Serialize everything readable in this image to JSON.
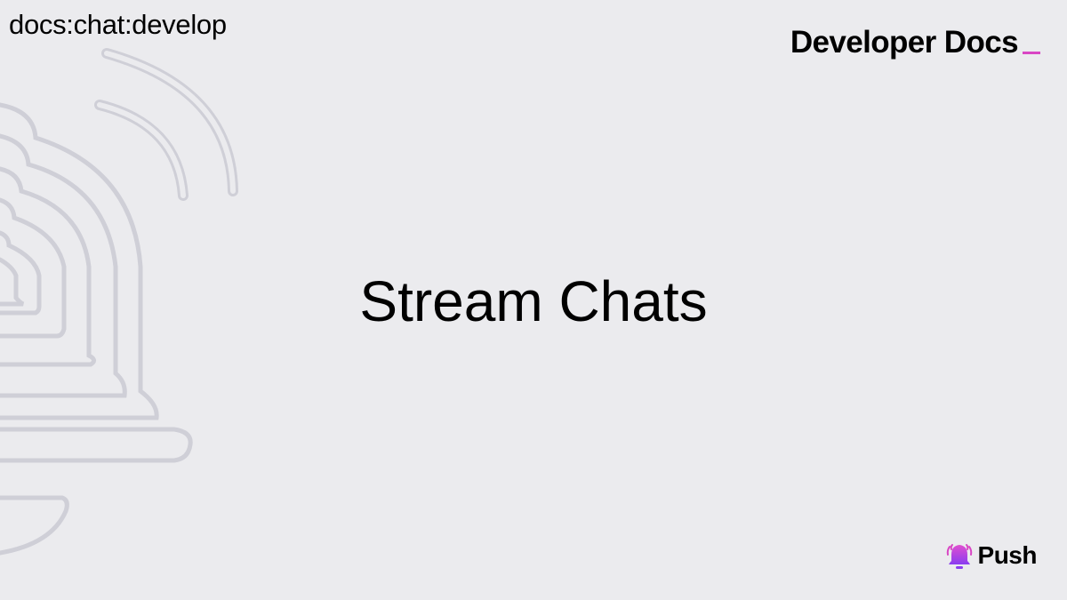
{
  "header": {
    "breadcrumb": "docs:chat:develop",
    "brand": "Developer Docs"
  },
  "main": {
    "title": "Stream Chats"
  },
  "footer": {
    "logo_text": "Push",
    "logo_icon": "bell-icon"
  },
  "colors": {
    "background": "#ebebee",
    "accent": "#d946c4",
    "decor_stroke": "#cfcfd7"
  }
}
